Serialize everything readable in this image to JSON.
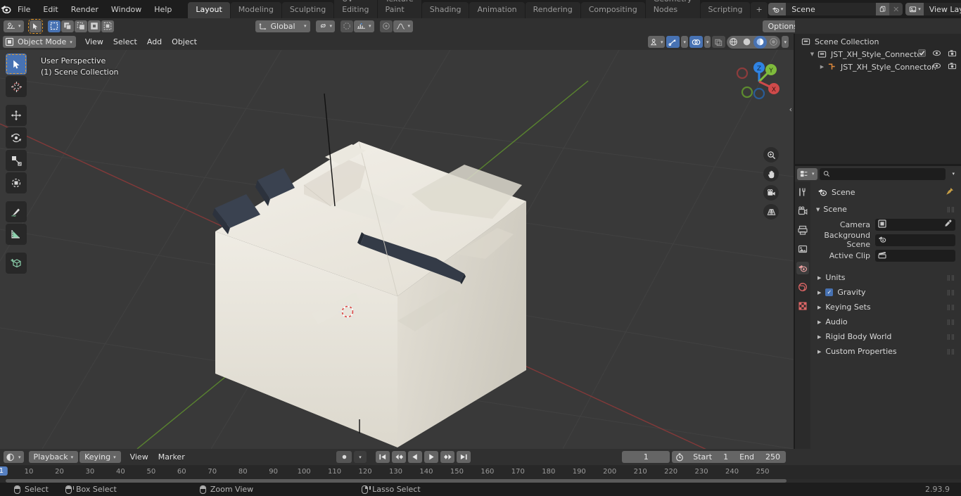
{
  "app": {
    "name": "Blender",
    "version": "2.93.9"
  },
  "topbar": {
    "menus": [
      "File",
      "Edit",
      "Render",
      "Window",
      "Help"
    ],
    "workspaces": [
      {
        "label": "Layout",
        "active": true
      },
      {
        "label": "Modeling",
        "active": false
      },
      {
        "label": "Sculpting",
        "active": false
      },
      {
        "label": "UV Editing",
        "active": false
      },
      {
        "label": "Texture Paint",
        "active": false
      },
      {
        "label": "Shading",
        "active": false
      },
      {
        "label": "Animation",
        "active": false
      },
      {
        "label": "Rendering",
        "active": false
      },
      {
        "label": "Compositing",
        "active": false
      },
      {
        "label": "Geometry Nodes",
        "active": false
      },
      {
        "label": "Scripting",
        "active": false
      },
      {
        "label": "+",
        "active": false
      }
    ],
    "scene_name": "Scene",
    "view_layer_name": "View Layer"
  },
  "tool_settings": {
    "transform_orientation": "Global",
    "options_label": "Options",
    "outliner_search_placeholder": ""
  },
  "viewport_header": {
    "mode": "Object Mode",
    "menus": [
      "View",
      "Select",
      "Add",
      "Object"
    ]
  },
  "viewport": {
    "perspective_label": "User Perspective",
    "collection_label": "(1) Scene Collection",
    "gizmo_axes": [
      "X",
      "Y",
      "Z"
    ],
    "nav_icons": [
      "zoom-icon",
      "hand-icon",
      "camera-icon",
      "grid-icon"
    ],
    "tools": [
      "tweak-select-tool",
      "cursor-tool",
      "move-tool",
      "rotate-tool",
      "scale-tool",
      "transform-tool",
      "annotate-tool",
      "measure-tool",
      "add-cube-tool"
    ]
  },
  "outliner": {
    "rows": [
      {
        "label": "Scene Collection",
        "indent": 0,
        "icon": "collection-icon",
        "has_disclosure": false,
        "checkbox": false,
        "eye": false,
        "camera": false
      },
      {
        "label": "JST_XH_Style_Connector",
        "indent": 1,
        "icon": "collection-icon",
        "has_disclosure": true,
        "checkbox": true,
        "eye": true,
        "camera": true
      },
      {
        "label": "JST_XH_Style_Connector.",
        "indent": 2,
        "icon": "mesh-object-icon",
        "has_disclosure": true,
        "checkbox": false,
        "eye": true,
        "camera": true
      }
    ]
  },
  "properties": {
    "breadcrumb": "Scene",
    "panels": [
      {
        "label": "Scene",
        "open": true,
        "checkbox": false
      },
      {
        "label": "Units",
        "open": false,
        "checkbox": false
      },
      {
        "label": "Gravity",
        "open": false,
        "checkbox": true
      },
      {
        "label": "Keying Sets",
        "open": false,
        "checkbox": false
      },
      {
        "label": "Audio",
        "open": false,
        "checkbox": false
      },
      {
        "label": "Rigid Body World",
        "open": false,
        "checkbox": false
      },
      {
        "label": "Custom Properties",
        "open": false,
        "checkbox": false
      }
    ],
    "scene_fields": [
      {
        "label": "Camera",
        "value": "",
        "icon": "camera-data-icon",
        "eyedropper": true
      },
      {
        "label": "Background Scene",
        "value": "",
        "icon": "scene-icon",
        "eyedropper": false
      },
      {
        "label": "Active Clip",
        "value": "",
        "icon": "clip-icon",
        "eyedropper": false
      }
    ],
    "tabs": [
      "tool-icon",
      "render-icon",
      "output-icon",
      "view-layer-icon",
      "scene-icon",
      "world-icon",
      "texture-icon"
    ]
  },
  "timeline": {
    "menus": [
      "View",
      "Marker"
    ],
    "dropdowns": [
      "Playback",
      "Keying"
    ],
    "current_frame": "1",
    "start_label": "Start",
    "start_value": "1",
    "end_label": "End",
    "end_value": "250",
    "playhead_frame": "1",
    "ruler_ticks": [
      "10",
      "20",
      "30",
      "40",
      "50",
      "60",
      "70",
      "80",
      "90",
      "100",
      "110",
      "120",
      "130",
      "140",
      "150",
      "160",
      "170",
      "180",
      "190",
      "200",
      "210",
      "220",
      "230",
      "240",
      "250"
    ],
    "transport": [
      "jump-to-start-icon",
      "jump-prev-keyframe-icon",
      "play-reverse-icon",
      "play-icon",
      "jump-next-keyframe-icon",
      "jump-to-end-icon"
    ]
  },
  "statusbar": {
    "items": [
      {
        "icon": "mouse-left-icon",
        "label": "Select"
      },
      {
        "icon": "mouse-left-drag-icon",
        "label": "Box Select"
      },
      {
        "icon": "mouse-middle-icon",
        "label": "Zoom View"
      },
      {
        "icon": "mouse-right-drag-icon",
        "label": "Lasso Select"
      }
    ],
    "version": "2.93.9"
  },
  "colors": {
    "accent": "#4772b3",
    "orange": "#e79c2a",
    "axis_x": "#cf4a4a",
    "axis_y": "#7fbb3c",
    "axis_z": "#2f83e3",
    "bg_dark": "#1d1d1d",
    "bg_panel": "#303030",
    "viewport_bg": "#393939"
  }
}
